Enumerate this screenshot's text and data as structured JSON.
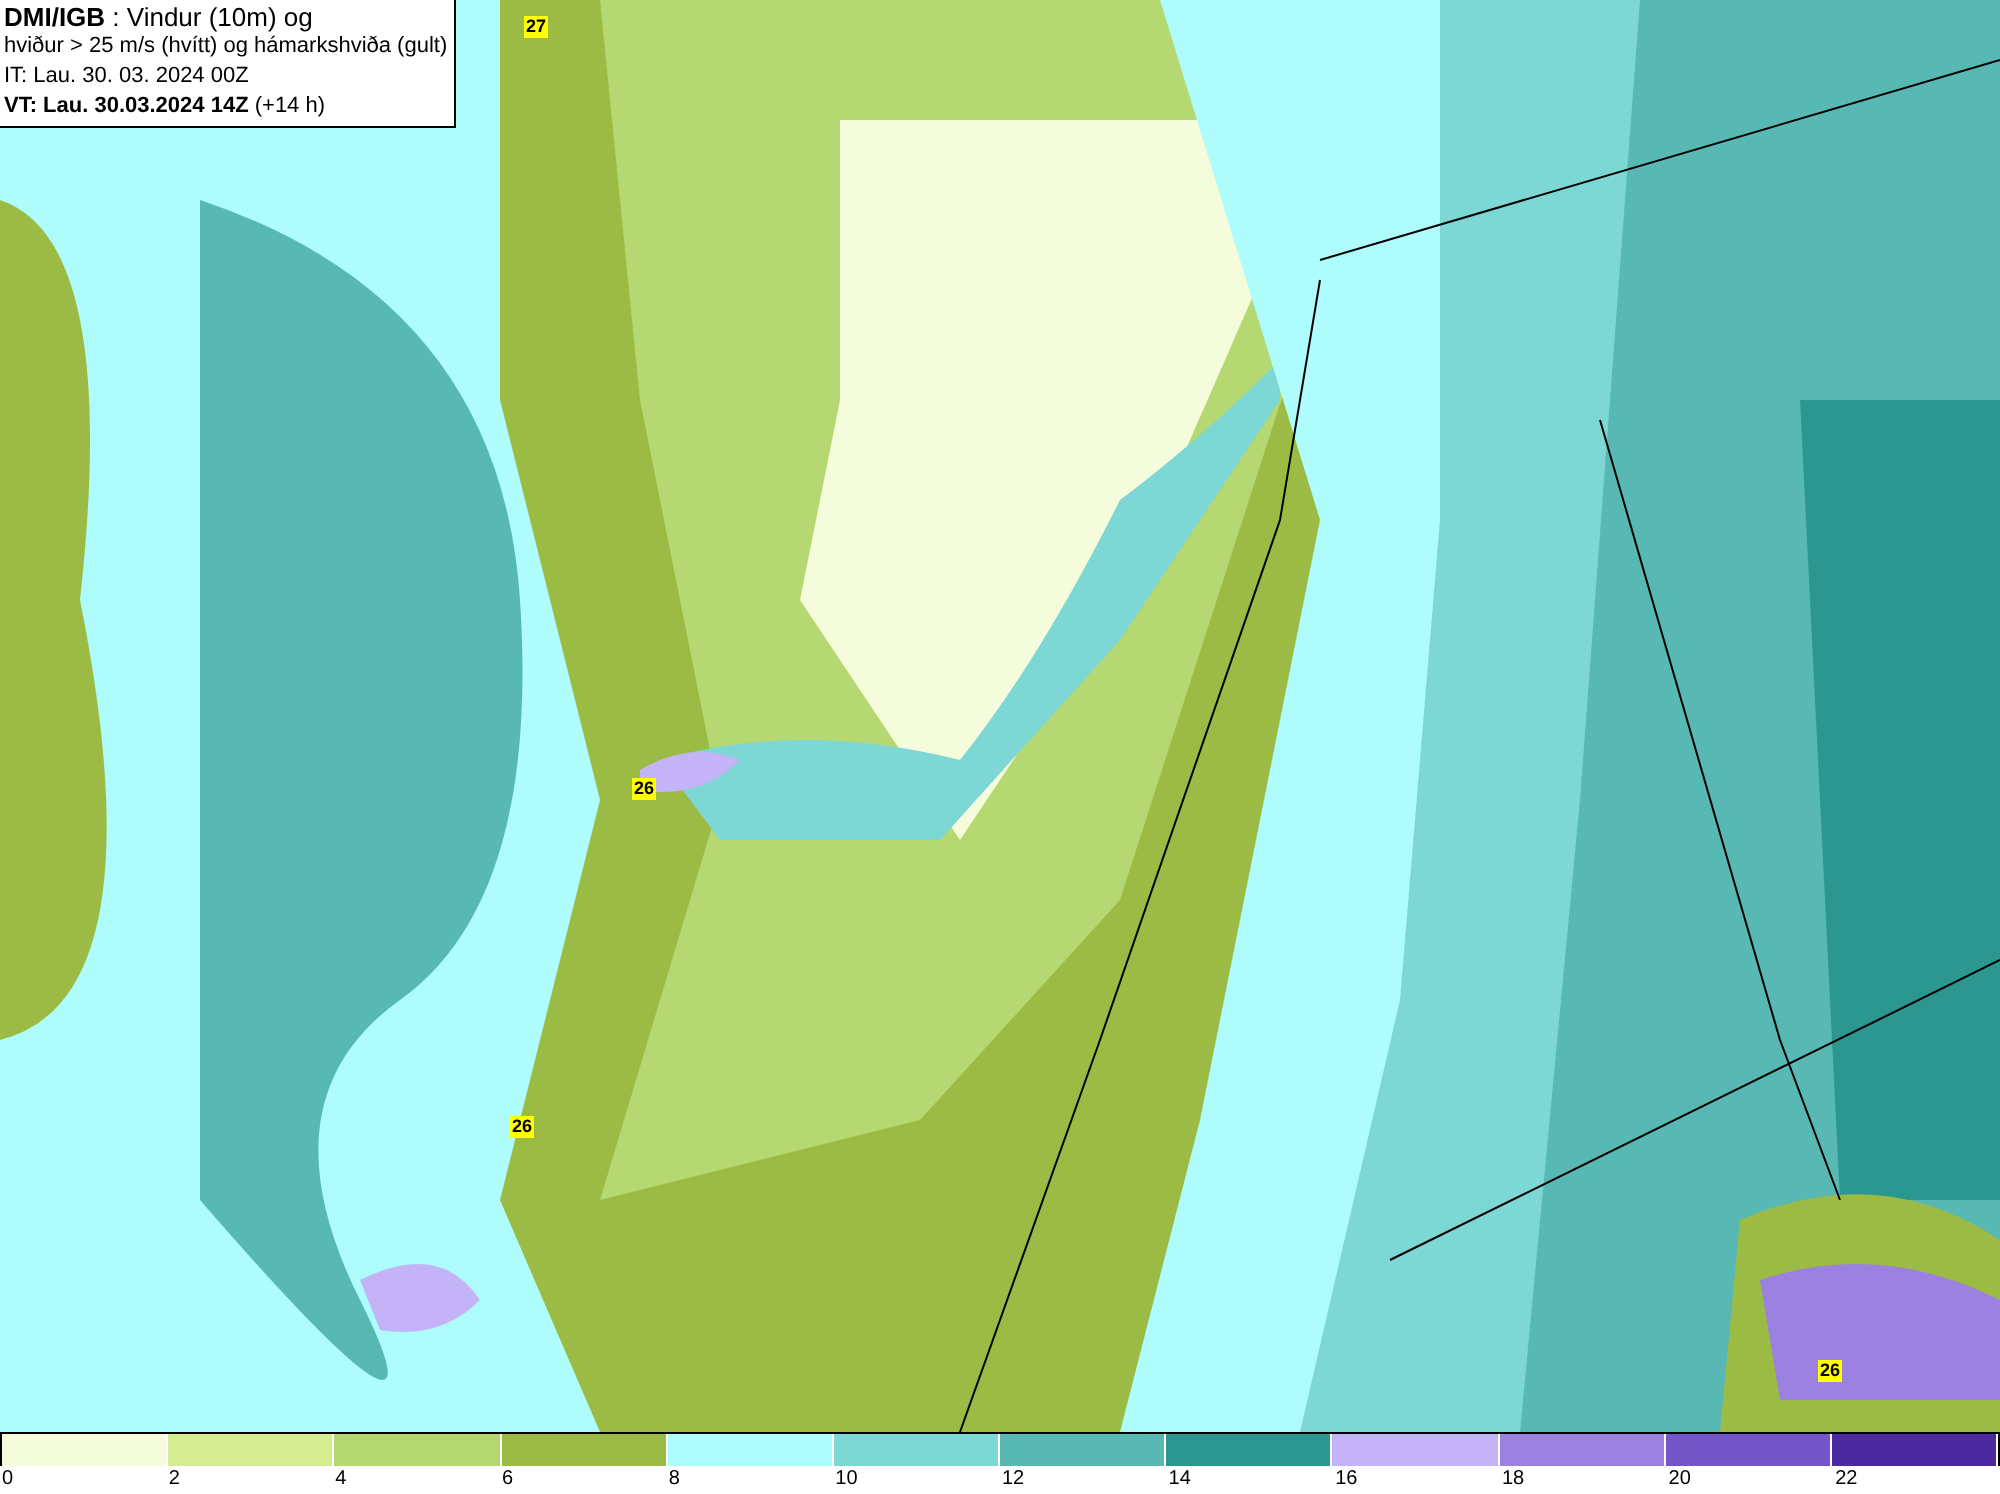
{
  "info_box": {
    "lines": [
      "**DMI/IGB** : Vindur (10m) og",
      "hviður > 25 m/s (hvítt) og hámarkshviða (gult)",
      "IT: Lau. 30. 03. 2024 00Z",
      "**VT: Lau. 30.03.2024 14Z** (+14 h)"
    ]
  },
  "gust_labels": [
    {
      "value": "27"
    },
    {
      "value": "26"
    },
    {
      "value": "26"
    },
    {
      "value": "26"
    }
  ],
  "legend": {
    "bins": [
      {
        "color": "#f5fcdc"
      },
      {
        "color": "#d6ec90"
      },
      {
        "color": "#b5d872"
      },
      {
        "color": "#9cbb44"
      },
      {
        "color": "#aefcfc"
      },
      {
        "color": "#7dd7d4"
      },
      {
        "color": "#58b8b4"
      },
      {
        "color": "#2c9690"
      },
      {
        "color": "#c5b3f7"
      },
      {
        "color": "#9b82e0"
      },
      {
        "color": "#7456c9"
      },
      {
        "color": "#4b2aa0"
      }
    ],
    "ticks": [
      "0",
      "2",
      "4",
      "6",
      "8",
      "10",
      "12",
      "14",
      "16",
      "18",
      "20",
      "22"
    ]
  }
}
